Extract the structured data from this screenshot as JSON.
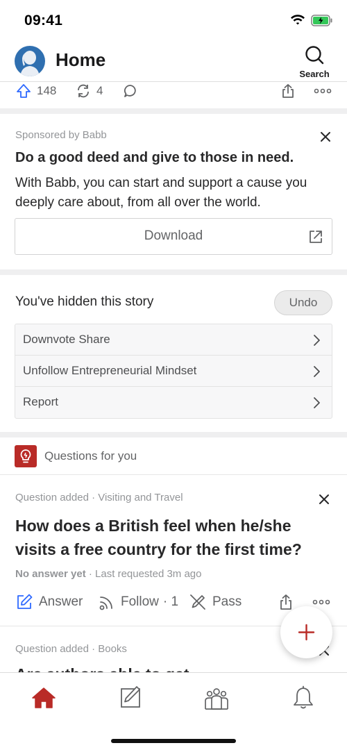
{
  "status_bar": {
    "time": "09:41"
  },
  "header": {
    "title": "Home",
    "search_label": "Search"
  },
  "prev_story_actions": {
    "upvotes": "148",
    "shares": "4"
  },
  "ad": {
    "sponsor": "Sponsored by Babb",
    "title": "Do a good deed and give to those in need.",
    "body": "With Babb, you can start and support a cause you deeply care about, from all over the world.",
    "cta": "Download"
  },
  "hidden_story": {
    "message": "You've hidden this story",
    "undo_label": "Undo",
    "options": [
      {
        "label": "Downvote Share"
      },
      {
        "label": "Unfollow Entrepreneurial Mindset"
      },
      {
        "label": "Report"
      }
    ]
  },
  "questions_section": {
    "label": "Questions for you"
  },
  "question": {
    "meta": "Question added · Visiting and Travel",
    "title": "How does a British feel when he/she visits a free country for the first time?",
    "status": "No answer yet",
    "requested": " · Last requested 3m ago",
    "answer_label": "Answer",
    "follow_label": "Follow",
    "follow_count": "· 1",
    "pass_label": "Pass"
  },
  "next_question": {
    "meta": "Question added · Books",
    "title_partial": "Are authors able to get"
  },
  "colors": {
    "brand_red": "#b92b27",
    "link_blue": "#2e69ff",
    "text": "#282829",
    "muted": "#939598"
  }
}
